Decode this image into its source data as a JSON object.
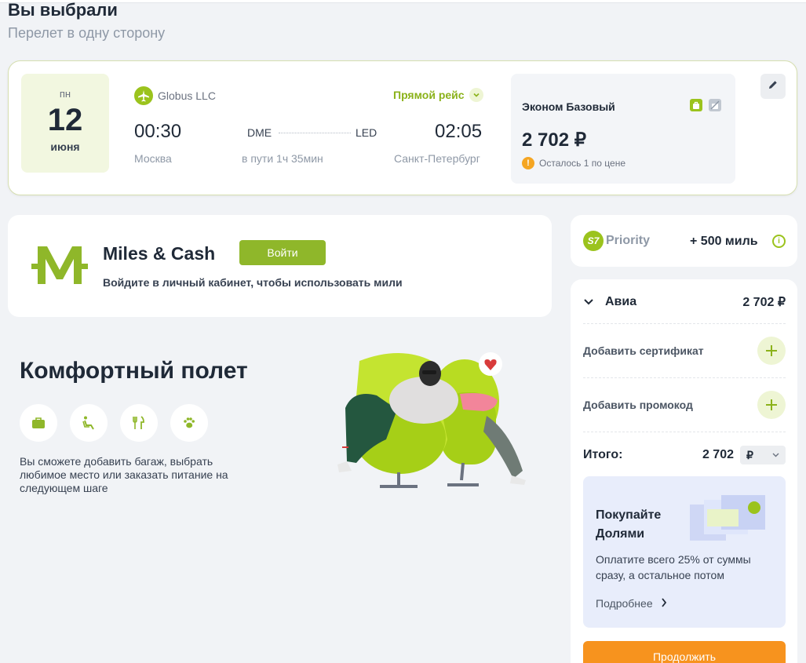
{
  "header": {
    "title": "Вы выбрали",
    "subtitle": "Перелет в одну сторону"
  },
  "flight": {
    "date": {
      "dow": "пн",
      "day": "12",
      "month": "июня"
    },
    "airline": {
      "name": "Globus LLC",
      "icon": "plane-icon"
    },
    "direct_label": "Прямой рейс",
    "departure": {
      "time": "00:30",
      "code": "DME",
      "city": "Москва"
    },
    "arrival": {
      "time": "02:05",
      "code": "LED",
      "city": "Санкт-Петербург"
    },
    "duration": "в пути 1ч 35мин",
    "fare": {
      "name": "Эконом Базовый",
      "price": "2 702 ₽",
      "warning": "Осталось 1 по цене",
      "icons": [
        "baggage-included-icon",
        "baggage-excluded-icon"
      ]
    },
    "edit_icon": "pencil-icon"
  },
  "miles": {
    "title": "Miles & Cash",
    "login_label": "Войти",
    "text": "Войдите в личный кабинет, чтобы использовать мили"
  },
  "comfort": {
    "title": "Комфортный полет",
    "icons": [
      "baggage-icon",
      "seat-icon",
      "meal-icon",
      "pet-icon"
    ],
    "text": "Вы сможете добавить багаж, выбрать любимое место или заказать питание на следующем шаге"
  },
  "priority": {
    "logo_text": "S7",
    "label": "Priority",
    "miles": "+ 500 миль"
  },
  "summary": {
    "avia_label": "Авиа",
    "avia_price": "2 702 ₽",
    "add_certificate": "Добавить сертификат",
    "add_promocode": "Добавить промокод",
    "total_label": "Итого:",
    "total_value": "2 702",
    "currency": "₽",
    "promo": {
      "title": "Покупайте Долями",
      "text": "Оплатите всего 25% от суммы сразу, а остальное потом",
      "link": "Подробнее"
    },
    "continue_label": "Продолжить"
  },
  "colors": {
    "brand_green": "#9bc31d",
    "button_green": "#8fb72a",
    "orange": "#f7931e",
    "promo_bg": "#e8edfb"
  }
}
